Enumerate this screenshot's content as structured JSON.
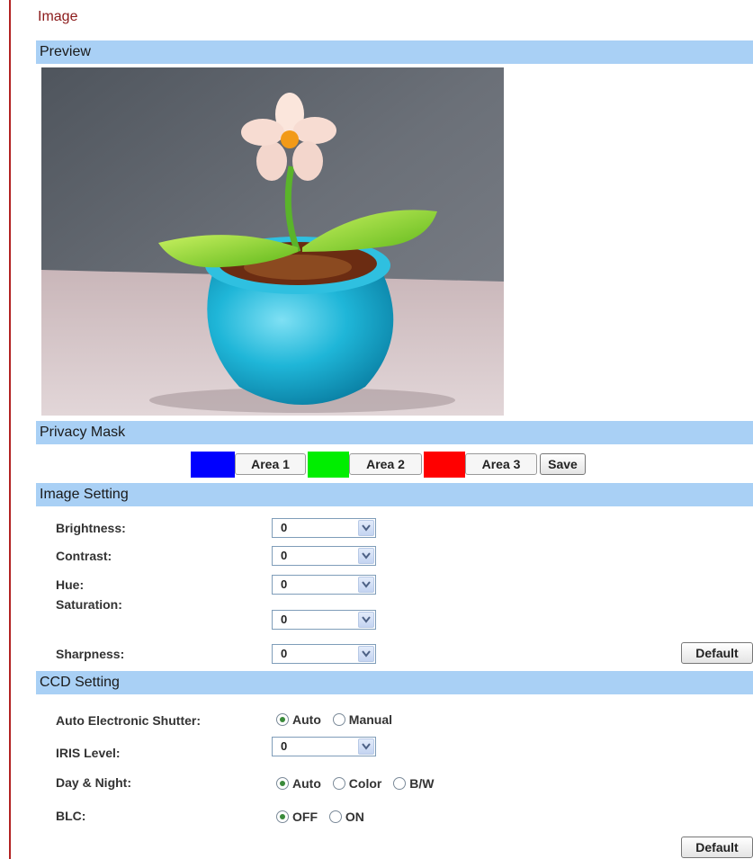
{
  "page_title": "Image",
  "sections": {
    "preview": "Preview",
    "privacy_mask": "Privacy Mask",
    "image_setting": "Image Setting",
    "ccd_setting": "CCD Setting"
  },
  "privacy_mask": {
    "areas": [
      {
        "label": "Area 1",
        "color": "#0000ff"
      },
      {
        "label": "Area 2",
        "color": "#00ee00"
      },
      {
        "label": "Area 3",
        "color": "#ff0000"
      }
    ],
    "save_label": "Save"
  },
  "image_setting": {
    "fields": [
      {
        "label": "Brightness:",
        "value": "0"
      },
      {
        "label": "Contrast:",
        "value": "0"
      },
      {
        "label": "Hue:",
        "value": "0"
      },
      {
        "label": "Saturation:",
        "value": "0"
      },
      {
        "label": "Sharpness:",
        "value": "0"
      }
    ],
    "default_label": "Default"
  },
  "ccd_setting": {
    "shutter": {
      "label": "Auto Electronic Shutter:",
      "options": [
        "Auto",
        "Manual"
      ],
      "selected": "Auto"
    },
    "iris": {
      "label": "IRIS Level:",
      "value": "0"
    },
    "day_night": {
      "label": "Day & Night:",
      "options": [
        "Auto",
        "Color",
        "B/W"
      ],
      "selected": "Auto"
    },
    "blc": {
      "label": "BLC:",
      "options": [
        "OFF",
        "ON"
      ],
      "selected": "OFF"
    },
    "default_label": "Default"
  },
  "colors": {
    "section_bar": "#a9d0f5",
    "title": "#8b1a1a",
    "left_rule": "#b22222"
  }
}
